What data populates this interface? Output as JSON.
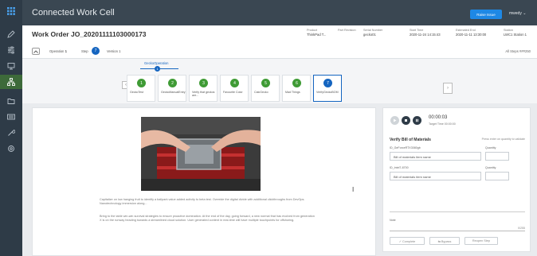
{
  "app": {
    "title": "Connected Work Cell"
  },
  "topbar": {
    "raise_button": "Raise Issue",
    "user": "mwedy"
  },
  "work_order": {
    "title": "Work Order JO_20201111103000173",
    "meta": [
      {
        "label": "Product",
        "value": "ThinkPad T..."
      },
      {
        "label": "Part Revision",
        "value": ""
      },
      {
        "label": "Serial Number",
        "value": "gecko01"
      },
      {
        "label": "Start Time",
        "value": "2020-11-24 14:15:43"
      },
      {
        "label": "Estimated End",
        "value": "2020-11-11 13:30:00"
      },
      {
        "label": "Station",
        "value": "LWC1 Station 1"
      }
    ],
    "operation_label": "Operation",
    "operation_value": "1",
    "step_label": "Step",
    "step_value": "7",
    "version_label": "Version",
    "version_value": "1",
    "all_steps": "All Steps ###250"
  },
  "stepper": {
    "active_tab": "GeckoOperation",
    "dot_value": "1",
    "prev_arrow": "‹",
    "next_arrow": "›",
    "steps": [
      {
        "num": "1",
        "label": "GeckoTest"
      },
      {
        "num": "2",
        "label": "GeckoManualEntry"
      },
      {
        "num": "3",
        "label": "Verify that geckos are..."
      },
      {
        "num": "4",
        "label": "Favourite Color"
      },
      {
        "num": "5",
        "label": "CalcGecko"
      },
      {
        "num": "6",
        "label": "Mad Things"
      },
      {
        "num": "7",
        "label": "VerifyGeckoBOM"
      }
    ]
  },
  "content": {
    "paragraph1": "Capitalize on low hanging fruit to identify a ballpark value added activity to beta test. Override the digital divide with additional clickthroughs from DevOps. Nanotechnology immersion along...",
    "paragraph2": "Bring to the table win-win survival strategies to ensure proactive domination. At the end of the day, going forward, a new normal that has evolved from generation X is on the runway heading towards a streamlined cloud solution. User generated content in real-time will have multiple touchpoints for offshoring.",
    "cursor": "I"
  },
  "panel": {
    "timer": "00:00:03",
    "target": "Target Time 00:00:00",
    "bom_title": "Verify Bill of Materials",
    "bom_hint": "Press enter on quantity to validate",
    "items": [
      {
        "label": "ID_GeForceRTX3080gb",
        "placeholder": "Bill of materials item name",
        "qty_label": "Quantity"
      },
      {
        "label": "ID_Intel7-8700",
        "placeholder": "Bill of materials item name",
        "qty_label": "Quantity"
      }
    ],
    "note_label": "Note",
    "note_count": "0/255",
    "buttons": {
      "complete": "✓ Complete",
      "bypass": "⇆ Bypass",
      "reopen": "Reopen Step"
    },
    "colors": {
      "play": "#cfd4d8",
      "stop": "#2e3b47",
      "pause": "#2e3b47"
    }
  },
  "icons": [
    "grid-icon",
    "pencil-icon",
    "sliders-icon",
    "monitor-icon",
    "hierarchy-icon",
    "folder-icon",
    "keyboard-icon",
    "wrench-icon",
    "settings-icon"
  ]
}
